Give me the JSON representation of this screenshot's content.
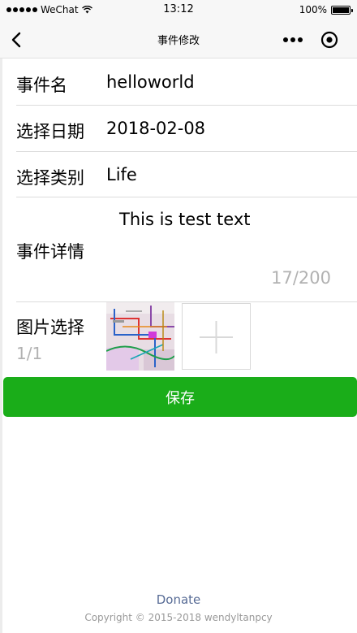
{
  "status_bar": {
    "carrier": "WeChat",
    "time": "13:12",
    "battery": "100%",
    "battery_level": 1.0
  },
  "nav": {
    "title": "事件修改",
    "back_icon": "chevron-left-icon",
    "more_icon": "more-dots-icon",
    "close_icon": "close-circle-icon"
  },
  "form": {
    "name_label": "事件名",
    "name_value": "helloworld",
    "date_label": "选择日期",
    "date_value": "2018-02-08",
    "category_label": "选择类别",
    "category_value": "Life",
    "detail_label": "事件详情",
    "detail_value": "This is test text",
    "detail_counter": "17/200",
    "image_label": "图片选择",
    "image_counter": "1/1",
    "add_icon": "plus-icon"
  },
  "save_button": "保存",
  "footer": {
    "link": "Donate",
    "copyright": "Copyright © 2015-2018 wendyltanpcy"
  },
  "colors": {
    "accent": "#1aad19",
    "link": "#576b95",
    "muted": "#b2b2b2"
  }
}
